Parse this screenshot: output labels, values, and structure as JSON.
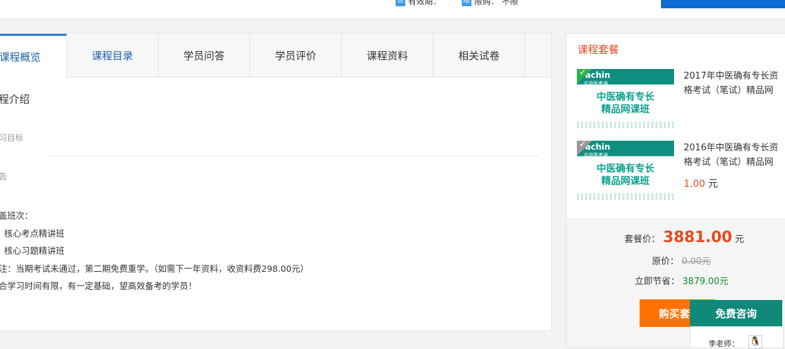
{
  "top": {
    "validity_label": "有效期：",
    "limit_label": "限购：",
    "limit_value": "不限",
    "validity_icon": "calendar-icon",
    "limit_icon": "limit-icon"
  },
  "tabs": [
    "课程概览",
    "课程目录",
    "学员问答",
    "学员评价",
    "课程资料",
    "相关试卷"
  ],
  "content": {
    "title": "程介绍",
    "sub1": "习目标",
    "sub2": "告",
    "lines": [
      "盖班次：",
      "  核心考点精讲班",
      "  核心习题精讲班",
      "注：当期考试未通过，第二期免费重学。（如需下一年资料，收资料费298.00元）",
      "合学习时间有限，有一定基础，望高效备考的学员！"
    ]
  },
  "sidebar": {
    "title": "课程套餐",
    "packages": [
      {
        "name": "2017年中医确有专长资格考试（笔试）精品网",
        "price": "",
        "unit": "",
        "thumb_brand": "achin",
        "thumb_line1": "中医确有专长",
        "thumb_line2": "精品网课班",
        "thumb_sub": "实验医考通"
      },
      {
        "name": "2016年中医确有专长资格考试（笔试）精品网",
        "price": "1.00",
        "unit": "元",
        "thumb_brand": "achin",
        "thumb_line1": "中医确有专长",
        "thumb_line2": "精品网课班",
        "thumb_sub": "实验医考通"
      }
    ]
  },
  "summary": {
    "price_label": "套餐价：",
    "price_value": "3881.00",
    "price_unit": "元",
    "orig_label": "原价：",
    "orig_value": "0.00元",
    "save_label": "立即节省：",
    "save_value": "3879.00元",
    "buy_label": "购买套餐",
    "consult_label": "免费咨询",
    "teacher_label": "李老师：",
    "qq_icon": "qq-icon"
  },
  "colors": {
    "accent": "#e8491d",
    "tab_blue": "#1d5ea8",
    "buy": "#ff7200",
    "consult": "#10897b"
  }
}
